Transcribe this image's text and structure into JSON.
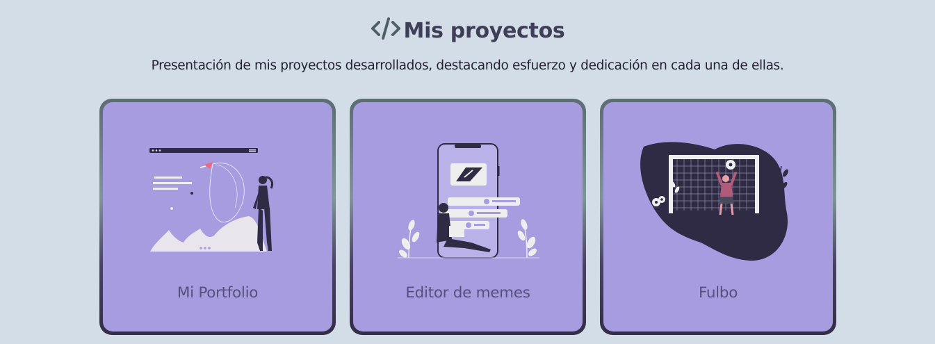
{
  "header": {
    "icon": "code-icon",
    "title": "Mis proyectos",
    "subtitle": "Presentación de mis proyectos desarrollados, destacando esfuerzo y dedicación en cada una de ellas."
  },
  "colors": {
    "background": "#d3dde7",
    "card_fill": "#a79ce0",
    "title_text": "#3e3e58",
    "icon": "#4f5f63"
  },
  "projects": [
    {
      "label": "Mi Portfolio",
      "illustration": "portfolio-illustration"
    },
    {
      "label": "Editor de memes",
      "illustration": "meme-editor-illustration"
    },
    {
      "label": "Fulbo",
      "illustration": "soccer-goal-illustration"
    }
  ]
}
